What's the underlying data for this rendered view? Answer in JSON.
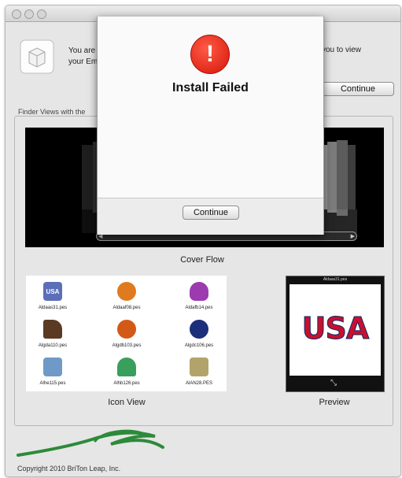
{
  "intro": {
    "text_line1": "You are",
    "text_line2": "your Em",
    "text_right": "you to view",
    "continue_label": "Continue"
  },
  "group_label": "Finder Views with the",
  "captions": {
    "cover_flow": "Cover Flow",
    "icon_view": "Icon View",
    "preview": "Preview"
  },
  "icon_view": {
    "items": [
      {
        "label": "Aldaas31.pes",
        "icon": "usa-badge-icon",
        "color": "#5b6fb8",
        "glyph": "USA"
      },
      {
        "label": "Aldaaf08.pes",
        "icon": "pineapple-icon",
        "color": "#e07a1f",
        "glyph": ""
      },
      {
        "label": "Aldafb14.pes",
        "icon": "butterfly-icon",
        "color": "#9c3bb0",
        "glyph": ""
      },
      {
        "label": "Algda110.pes",
        "icon": "boot-icon",
        "color": "#5a3a22",
        "glyph": ""
      },
      {
        "label": "Algdb103.pes",
        "icon": "basketball-icon",
        "color": "#d25a16",
        "glyph": ""
      },
      {
        "label": "Algdc106.pes",
        "icon": "jersey-icon",
        "color": "#1c2f7a",
        "glyph": ""
      },
      {
        "label": "Alhe115.pes",
        "icon": "bird-icon",
        "color": "#6f9ac8",
        "glyph": ""
      },
      {
        "label": "Alhb126.pes",
        "icon": "umbrella-icon",
        "color": "#3a9f5c",
        "glyph": ""
      },
      {
        "label": "AlAN28.PES",
        "icon": "sheep-icon",
        "color": "#b2a36a",
        "glyph": ""
      }
    ]
  },
  "preview": {
    "title": "Aldaas31.pes",
    "word": "USA",
    "colors": {
      "red": "#c8102e",
      "blue": "#0b2a6b"
    }
  },
  "copyright": "Copyright 2010 BriTon Leap, Inc.",
  "alert": {
    "title": "Install Failed",
    "icon_glyph": "!",
    "button_label": "Continue"
  }
}
